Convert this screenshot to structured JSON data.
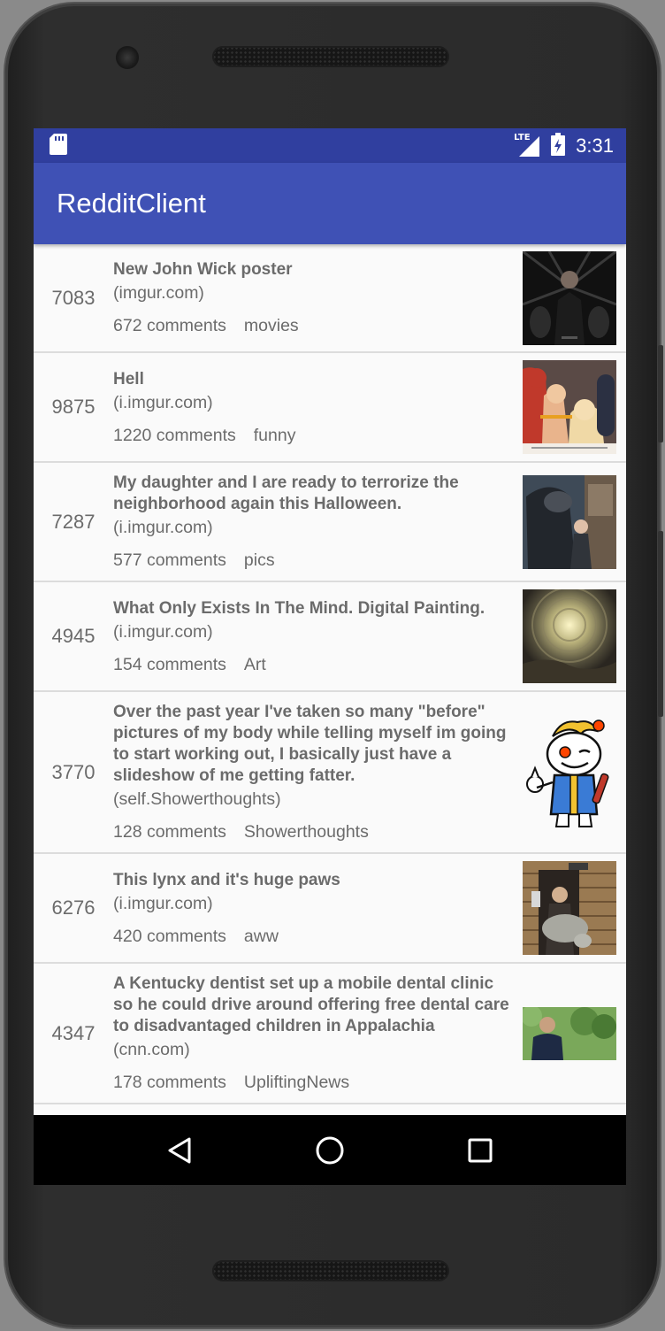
{
  "status_bar": {
    "time": "3:31",
    "network_label": "LTE",
    "icons": [
      "sd-card-icon",
      "lte-signal-icon",
      "battery-icon"
    ]
  },
  "app_bar": {
    "title": "RedditClient",
    "background": "#3f51b5",
    "status_background": "#303f9f"
  },
  "posts": [
    {
      "score": "7083",
      "title": "New John Wick poster",
      "domain": "(imgur.com)",
      "comments": "672 comments",
      "subreddit": "movies"
    },
    {
      "score": "9875",
      "title": "Hell",
      "domain": "(i.imgur.com)",
      "comments": "1220 comments",
      "subreddit": "funny"
    },
    {
      "score": "7287",
      "title": "My daughter and I are ready to terrorize the neighborhood again this Halloween.",
      "domain": "(i.imgur.com)",
      "comments": "577 comments",
      "subreddit": "pics"
    },
    {
      "score": "4945",
      "title": "What Only Exists In The Mind. Digital Painting.",
      "domain": "(i.imgur.com)",
      "comments": "154 comments",
      "subreddit": "Art"
    },
    {
      "score": "3770",
      "title": "Over the past year I've taken so many \"before\" pictures of my body while telling myself im going to start working out, I basically just have a slideshow of me getting fatter.",
      "domain": "(self.Showerthoughts)",
      "comments": "128 comments",
      "subreddit": "Showerthoughts"
    },
    {
      "score": "6276",
      "title": "This lynx and it's huge paws",
      "domain": "(i.imgur.com)",
      "comments": "420 comments",
      "subreddit": "aww"
    },
    {
      "score": "4347",
      "title": "A Kentucky dentist set up a mobile dental clinic so he could drive around offering free dental care to disadvantaged children in Appalachia",
      "domain": "(cnn.com)",
      "comments": "178 comments",
      "subreddit": "UpliftingNews"
    }
  ],
  "nav_bar": {
    "buttons": [
      "back-icon",
      "home-icon",
      "recents-icon"
    ]
  }
}
